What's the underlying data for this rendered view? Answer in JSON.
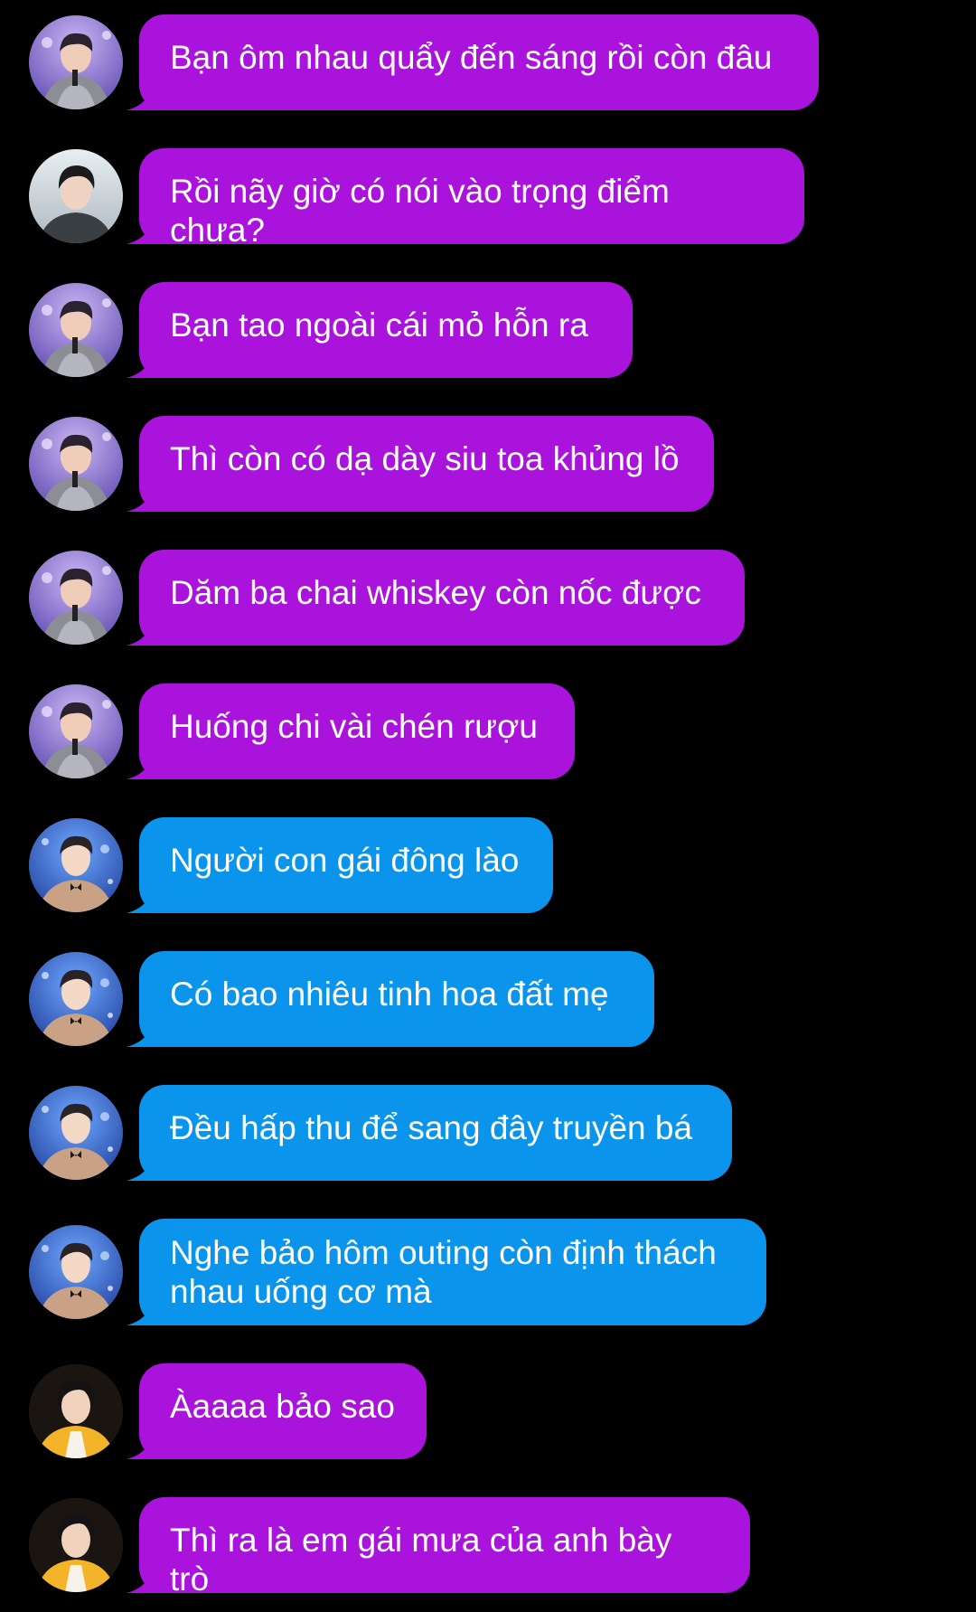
{
  "colors": {
    "background": "#000000",
    "bubble_purple": "#a913db",
    "bubble_blue": "#0b94ec",
    "text": "#ffffff"
  },
  "messages": [
    {
      "avatar": "avatar-1",
      "color": "purple",
      "text": "Bạn ôm nhau quẩy đến sáng rồi còn đâu"
    },
    {
      "avatar": "avatar-2",
      "color": "purple",
      "text": "Rồi nãy giờ có nói vào trọng điểm chưa?"
    },
    {
      "avatar": "avatar-1",
      "color": "purple",
      "text": "Bạn tao ngoài cái mỏ hỗn ra"
    },
    {
      "avatar": "avatar-1",
      "color": "purple",
      "text": "Thì còn có dạ dày siu toa khủng lồ"
    },
    {
      "avatar": "avatar-1",
      "color": "purple",
      "text": "Dăm ba chai whiskey còn nốc được"
    },
    {
      "avatar": "avatar-1",
      "color": "purple",
      "text": "Huống chi vài chén rượu"
    },
    {
      "avatar": "avatar-3",
      "color": "blue",
      "text": "Người con gái đông lào"
    },
    {
      "avatar": "avatar-3",
      "color": "blue",
      "text": "Có bao nhiêu tinh hoa đất mẹ"
    },
    {
      "avatar": "avatar-3",
      "color": "blue",
      "text": "Đều hấp thu để sang đây truyền bá"
    },
    {
      "avatar": "avatar-3",
      "color": "blue",
      "text": "Nghe bảo hôm outing còn định thách\nnhau uống cơ mà"
    },
    {
      "avatar": "avatar-4",
      "color": "purple",
      "text": "Àaaaa bảo sao"
    },
    {
      "avatar": "avatar-4",
      "color": "purple",
      "text": "Thì ra là em gái mưa của anh bày trò"
    }
  ]
}
